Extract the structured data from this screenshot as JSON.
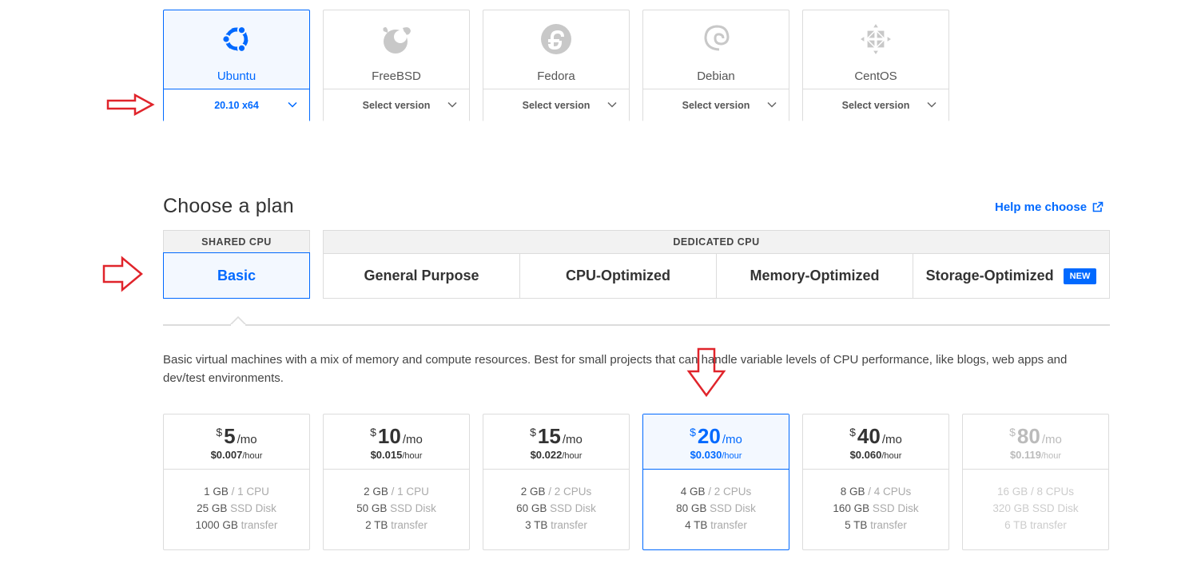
{
  "distros": [
    {
      "name": "Ubuntu",
      "version": "20.10 x64",
      "selected": true,
      "icon": "ubuntu-logo-icon"
    },
    {
      "name": "FreeBSD",
      "version": "Select version",
      "selected": false,
      "icon": "freebsd-logo-icon"
    },
    {
      "name": "Fedora",
      "version": "Select version",
      "selected": false,
      "icon": "fedora-logo-icon"
    },
    {
      "name": "Debian",
      "version": "Select version",
      "selected": false,
      "icon": "debian-logo-icon"
    },
    {
      "name": "CentOS",
      "version": "Select version",
      "selected": false,
      "icon": "centos-logo-icon"
    }
  ],
  "plan": {
    "title": "Choose a plan",
    "help_link": "Help me choose",
    "shared_header": "SHARED CPU",
    "basic_tab": "Basic",
    "dedicated_header": "DEDICATED CPU",
    "dedicated_tabs": [
      "General Purpose",
      "CPU-Optimized",
      "Memory-Optimized",
      "Storage-Optimized"
    ],
    "new_badge": "NEW",
    "description": "Basic virtual machines with a mix of memory and compute resources. Best for small projects that can handle variable levels of CPU performance, like blogs, web apps and dev/test environments."
  },
  "prices": [
    {
      "currency": "$",
      "amount": "5",
      "per": "/mo",
      "hourly": "$0.007",
      "hourly_unit": "/hour",
      "memory": "1 GB",
      "cpu": "/ 1 CPU",
      "disk": "25 GB",
      "disk_unit": "SSD Disk",
      "transfer": "1000 GB",
      "transfer_unit": "transfer",
      "state": "normal"
    },
    {
      "currency": "$",
      "amount": "10",
      "per": "/mo",
      "hourly": "$0.015",
      "hourly_unit": "/hour",
      "memory": "2 GB",
      "cpu": "/ 1 CPU",
      "disk": "50 GB",
      "disk_unit": "SSD Disk",
      "transfer": "2 TB",
      "transfer_unit": "transfer",
      "state": "normal"
    },
    {
      "currency": "$",
      "amount": "15",
      "per": "/mo",
      "hourly": "$0.022",
      "hourly_unit": "/hour",
      "memory": "2 GB",
      "cpu": "/ 2 CPUs",
      "disk": "60 GB",
      "disk_unit": "SSD Disk",
      "transfer": "3 TB",
      "transfer_unit": "transfer",
      "state": "normal"
    },
    {
      "currency": "$",
      "amount": "20",
      "per": "/mo",
      "hourly": "$0.030",
      "hourly_unit": "/hour",
      "memory": "4 GB",
      "cpu": "/ 2 CPUs",
      "disk": "80 GB",
      "disk_unit": "SSD Disk",
      "transfer": "4 TB",
      "transfer_unit": "transfer",
      "state": "selected"
    },
    {
      "currency": "$",
      "amount": "40",
      "per": "/mo",
      "hourly": "$0.060",
      "hourly_unit": "/hour",
      "memory": "8 GB",
      "cpu": "/ 4 CPUs",
      "disk": "160 GB",
      "disk_unit": "SSD Disk",
      "transfer": "5 TB",
      "transfer_unit": "transfer",
      "state": "normal"
    },
    {
      "currency": "$",
      "amount": "80",
      "per": "/mo",
      "hourly": "$0.119",
      "hourly_unit": "/hour",
      "memory": "16 GB",
      "cpu": "/ 8 CPUs",
      "disk": "320 GB",
      "disk_unit": "SSD Disk",
      "transfer": "6 TB",
      "transfer_unit": "transfer",
      "state": "disabled"
    }
  ],
  "colors": {
    "accent": "#0069ff",
    "annotation_arrow": "#e0242b",
    "border": "#dcdcdc"
  }
}
